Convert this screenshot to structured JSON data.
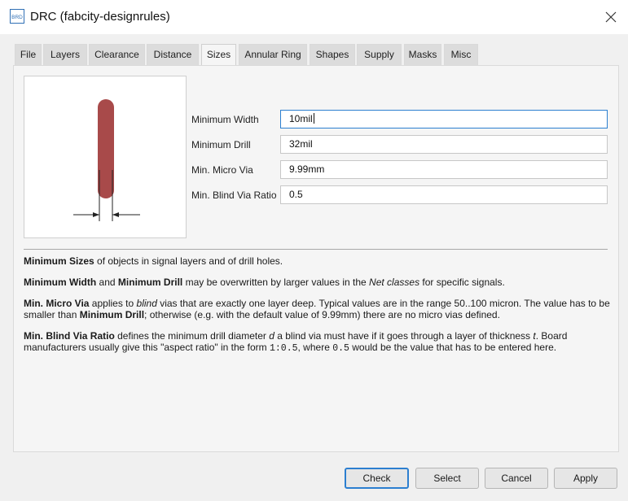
{
  "window": {
    "title": "DRC (fabcity-designrules)",
    "app_icon_text": "BRD",
    "accent_color": "#2c8ad8"
  },
  "tabs": [
    {
      "label": "File"
    },
    {
      "label": "Layers"
    },
    {
      "label": "Clearance"
    },
    {
      "label": "Distance"
    },
    {
      "label": "Sizes",
      "active": true
    },
    {
      "label": "Annular Ring"
    },
    {
      "label": "Shapes"
    },
    {
      "label": "Supply"
    },
    {
      "label": "Masks"
    },
    {
      "label": "Misc"
    }
  ],
  "preview": {
    "via_color": "#a84a4a",
    "icon": "min-width-diagram"
  },
  "fields": {
    "min_width": {
      "label": "Minimum Width",
      "value": "10mil"
    },
    "min_drill": {
      "label": "Minimum Drill",
      "value": "32mil"
    },
    "min_micro_via": {
      "label": "Min. Micro Via",
      "value": "9.99mm"
    },
    "min_blind_via_ratio": {
      "label": "Min. Blind Via Ratio",
      "value": "0.5"
    }
  },
  "help": {
    "p1": {
      "b1": "Minimum Sizes",
      "t1": " of objects in signal layers and of drill holes."
    },
    "p2": {
      "b1": "Minimum Width",
      "t1": " and ",
      "b2": "Minimum Drill",
      "t2": " may be overwritten by larger values in the ",
      "i1": "Net classes",
      "t3": " for specific signals."
    },
    "p3": {
      "b1": "Min. Micro Via",
      "t1": " applies to ",
      "i1": "blind",
      "t2": " vias that are exactly one layer deep. Typical values are in the range 50..100 micron. The value has to be smaller than ",
      "b2": "Minimum Drill",
      "t3": "; otherwise (e.g. with the default value of 9.99mm) there are no micro vias defined."
    },
    "p4": {
      "b1": "Min. Blind Via Ratio",
      "t1": " defines the minimum drill diameter ",
      "i1": "d",
      "t2": " a blind via must have if it goes through a layer of thickness ",
      "i2": "t",
      "t3": ". Board manufacturers usually give this \"aspect ratio\" in the form ",
      "m1": "1:0.5",
      "t4": ", where ",
      "m2": "0.5",
      "t5": " would be the value that has to be entered here."
    }
  },
  "buttons": {
    "check": "Check",
    "select": "Select",
    "cancel": "Cancel",
    "apply": "Apply"
  }
}
